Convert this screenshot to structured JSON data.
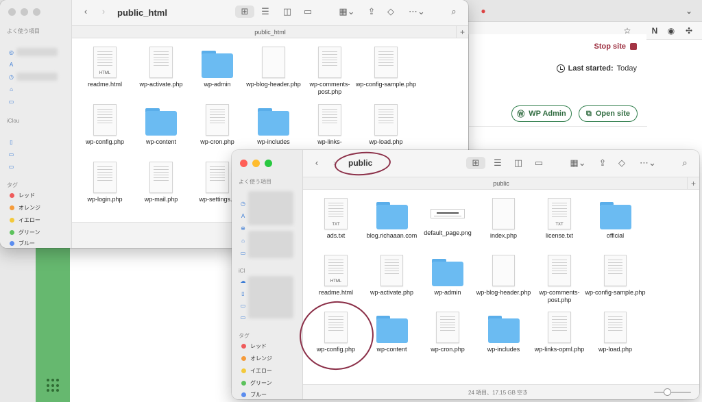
{
  "browser": {
    "site_panel": {
      "stop_site": "Stop site",
      "last_started_label": "Last started:",
      "last_started_value": "Today",
      "wp_admin": "WP Admin",
      "open_site": "Open site"
    },
    "colors": {
      "green_bar": "#66b86f",
      "stop": "#a33444",
      "button_border": "#2e7d4a"
    }
  },
  "finder_back": {
    "title": "public_html",
    "path": "public_html",
    "sidebar": {
      "favorites": "よく使う項目",
      "icloud": "iClou",
      "tags_header": "タグ",
      "tags": [
        {
          "name": "レッド",
          "color": "#ef5b5b"
        },
        {
          "name": "オレンジ",
          "color": "#f59b3a"
        },
        {
          "name": "イエロー",
          "color": "#f3c93b"
        },
        {
          "name": "グリーン",
          "color": "#5cc25c"
        },
        {
          "name": "ブルー",
          "color": "#5b8def"
        }
      ]
    },
    "files": [
      {
        "name": "readme.html",
        "kind": "doc",
        "tag": "HTML"
      },
      {
        "name": "wp-activate.php",
        "kind": "doc",
        "tag": ""
      },
      {
        "name": "wp-admin",
        "kind": "folder",
        "tag": ""
      },
      {
        "name": "wp-blog-header.php",
        "kind": "blank",
        "tag": ""
      },
      {
        "name": "wp-comments-post.php",
        "kind": "doc",
        "tag": ""
      },
      {
        "name": "wp-config-sample.php",
        "kind": "doc",
        "tag": ""
      },
      {
        "name": "wp-config.php",
        "kind": "doc",
        "tag": ""
      },
      {
        "name": "wp-content",
        "kind": "folder",
        "tag": ""
      },
      {
        "name": "wp-cron.php",
        "kind": "doc",
        "tag": ""
      },
      {
        "name": "wp-includes",
        "kind": "folder",
        "tag": ""
      },
      {
        "name": "wp-links-",
        "kind": "doc",
        "tag": ""
      },
      {
        "name": "wp-load.php",
        "kind": "doc",
        "tag": ""
      },
      {
        "name": "wp-login.php",
        "kind": "doc",
        "tag": ""
      },
      {
        "name": "wp-mail.php",
        "kind": "doc",
        "tag": ""
      },
      {
        "name": "wp-settings.p",
        "kind": "doc",
        "tag": ""
      }
    ]
  },
  "finder_front": {
    "title": "public",
    "path": "public",
    "status": "24 項目、17.15 GB 空き",
    "zoom_level": 0.35,
    "sidebar": {
      "favorites": "よく使う項目",
      "icloud": "iCl",
      "tags_header": "タグ",
      "tags": [
        {
          "name": "レッド",
          "color": "#ef5b5b"
        },
        {
          "name": "オレンジ",
          "color": "#f59b3a"
        },
        {
          "name": "イエロー",
          "color": "#f3c93b"
        },
        {
          "name": "グリーン",
          "color": "#5cc25c"
        },
        {
          "name": "ブルー",
          "color": "#5b8def"
        }
      ]
    },
    "files": [
      {
        "name": "ads.txt",
        "kind": "doc",
        "tag": "TXT"
      },
      {
        "name": "blog.richaaan.com",
        "kind": "folder",
        "tag": ""
      },
      {
        "name": "default_page.png",
        "kind": "png",
        "tag": ""
      },
      {
        "name": "index.php",
        "kind": "blank",
        "tag": ""
      },
      {
        "name": "license.txt",
        "kind": "doc",
        "tag": "TXT"
      },
      {
        "name": "official",
        "kind": "folder",
        "tag": ""
      },
      {
        "name": "readme.html",
        "kind": "doc",
        "tag": "HTML"
      },
      {
        "name": "wp-activate.php",
        "kind": "doc",
        "tag": ""
      },
      {
        "name": "wp-admin",
        "kind": "folder",
        "tag": ""
      },
      {
        "name": "wp-blog-header.php",
        "kind": "blank",
        "tag": ""
      },
      {
        "name": "wp-comments-post.php",
        "kind": "doc",
        "tag": ""
      },
      {
        "name": "wp-config-sample.php",
        "kind": "doc",
        "tag": ""
      },
      {
        "name": "wp-config.php",
        "kind": "doc",
        "tag": ""
      },
      {
        "name": "wp-content",
        "kind": "folder",
        "tag": ""
      },
      {
        "name": "wp-cron.php",
        "kind": "doc",
        "tag": ""
      },
      {
        "name": "wp-includes",
        "kind": "folder",
        "tag": ""
      },
      {
        "name": "wp-links-opml.php",
        "kind": "doc",
        "tag": ""
      },
      {
        "name": "wp-load.php",
        "kind": "doc",
        "tag": ""
      }
    ]
  },
  "icons": {
    "back": "chevron-left-icon",
    "forward": "chevron-right-icon",
    "grid_view": "grid-view-icon",
    "list_view": "list-view-icon",
    "column_view": "column-view-icon",
    "gallery_view": "gallery-view-icon",
    "group": "group-icon",
    "share": "share-icon",
    "tag": "tag-icon",
    "more": "more-icon",
    "search": "search-icon"
  }
}
